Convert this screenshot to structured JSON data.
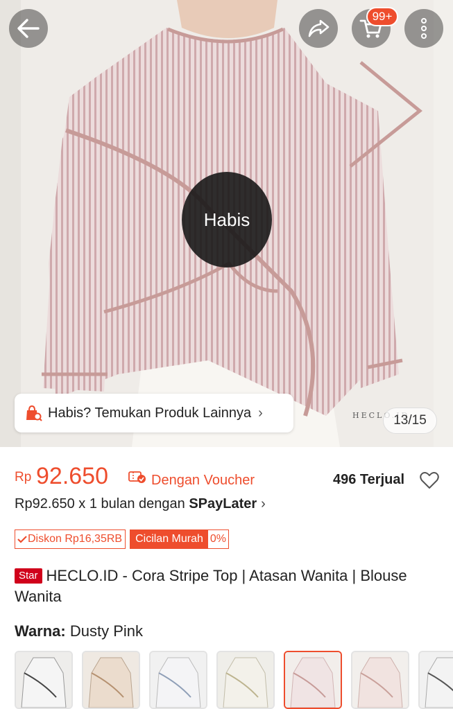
{
  "header": {
    "back_icon": "arrow-left-icon",
    "share_icon": "share-icon",
    "cart_icon": "cart-icon",
    "cart_badge": "99+",
    "more_icon": "more-vertical-icon"
  },
  "gallery": {
    "status_overlay": "Habis",
    "find_similar": "Habis? Temukan Produk Lainnya",
    "counter": "13/15",
    "watermark": "HECLO.ID"
  },
  "price": {
    "currency": "Rp",
    "value": "92.650",
    "voucher_label": "Dengan Voucher",
    "sold": "496 Terjual"
  },
  "paylater": {
    "prefix": "Rp92.650 x 1 bulan dengan ",
    "brand": "SPayLater"
  },
  "badges": {
    "discount": "Diskon Rp16,35RB",
    "installment": "Cicilan Murah",
    "installment_rate": "0%"
  },
  "product": {
    "star_badge": "Star",
    "title": "HECLO.ID - Cora Stripe Top | Atasan Wanita | Blouse Wanita"
  },
  "variant": {
    "label": "Warna:",
    "value": "Dusty Pink",
    "thumbnails": [
      "variant-1",
      "variant-2",
      "variant-3",
      "variant-4",
      "variant-5",
      "variant-6",
      "variant-7"
    ],
    "selected_index": 4
  },
  "colors": {
    "accent": "#ee4d2d",
    "star": "#d0011b"
  }
}
